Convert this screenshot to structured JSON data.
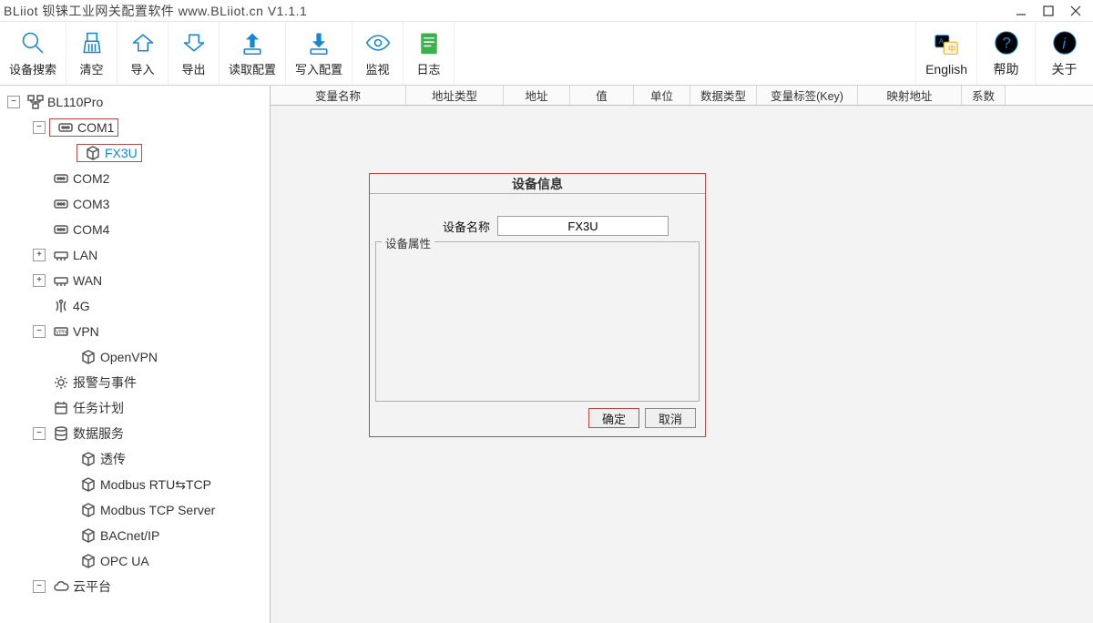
{
  "window": {
    "title": "BLiiot  钡铼工业网关配置软件 www.BLiiot.cn V1.1.1"
  },
  "toolbar": {
    "device_search": "设备搜索",
    "clear": "清空",
    "import": "导入",
    "export": "导出",
    "read_config": "读取配置",
    "write_config": "写入配置",
    "monitor": "监视",
    "log": "日志",
    "english": "English",
    "help": "帮助",
    "about": "关于"
  },
  "tree": {
    "root": "BL110Pro",
    "com1": "COM1",
    "fx3u": "FX3U",
    "com2": "COM2",
    "com3": "COM3",
    "com4": "COM4",
    "lan": "LAN",
    "wan": "WAN",
    "g4": "4G",
    "vpn": "VPN",
    "openvpn": "OpenVPN",
    "alarm": "报警与事件",
    "task": "任务计划",
    "dataservice": "数据服务",
    "passthru": "透传",
    "modbus_rtu_tcp": "Modbus RTU⇆TCP",
    "modbus_tcp_server": "Modbus TCP Server",
    "bacnet": "BACnet/IP",
    "opcua": "OPC UA",
    "cloud": "云平台"
  },
  "table": {
    "headers": [
      "变量名称",
      "地址类型",
      "地址",
      "值",
      "单位",
      "数据类型",
      "变量标签(Key)",
      "映射地址",
      "系数"
    ],
    "widths": [
      149,
      107,
      73,
      70,
      62,
      73,
      111,
      114,
      48
    ]
  },
  "dialog": {
    "title": "设备信息",
    "name_label": "设备名称",
    "name_value": "FX3U",
    "group_label": "设备属性",
    "ok": "确定",
    "cancel": "取消"
  }
}
